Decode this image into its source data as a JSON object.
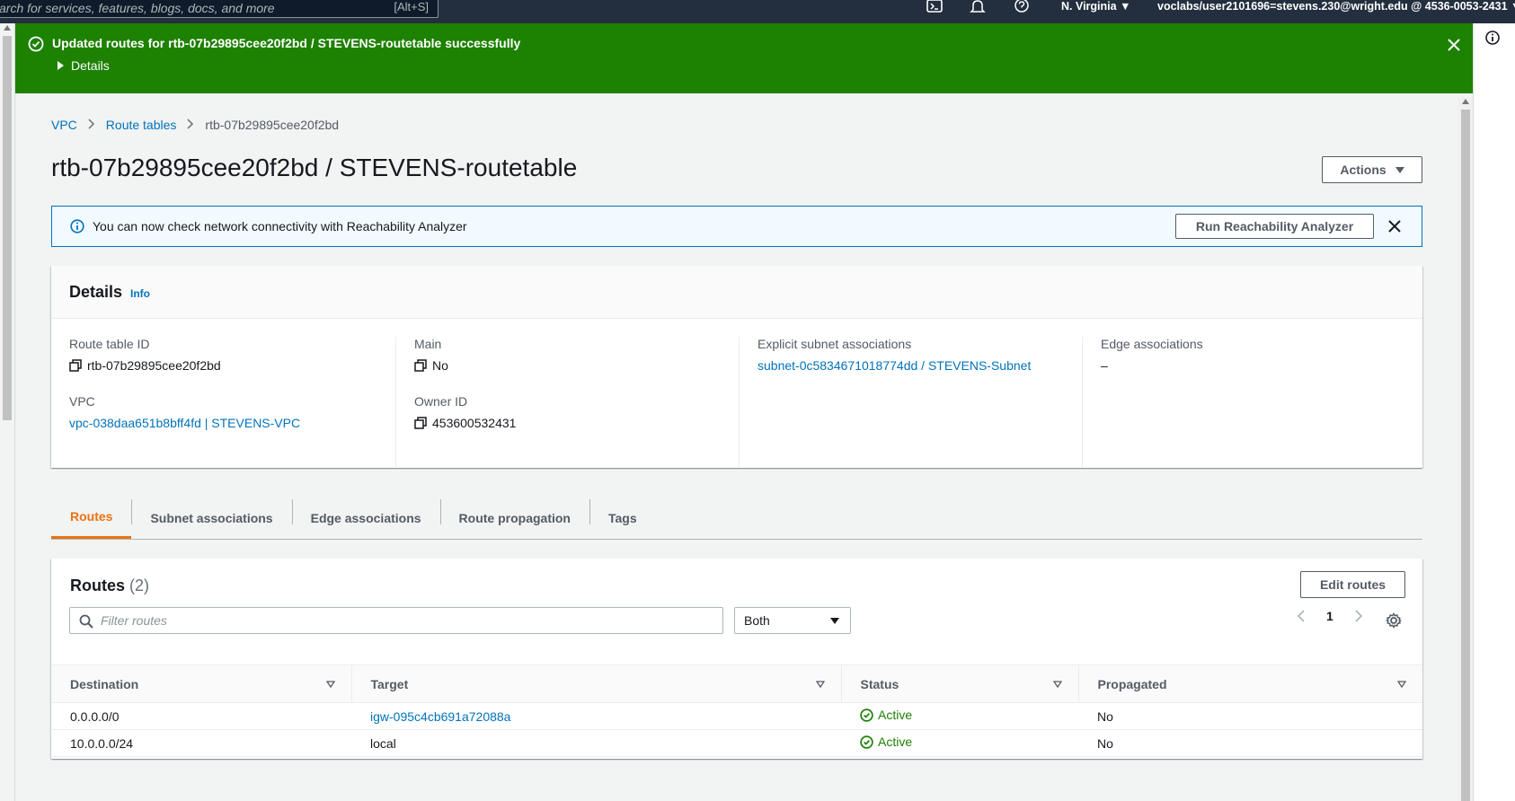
{
  "topnav": {
    "search_placeholder": "arch for services, features, blogs, docs, and more",
    "search_shortcut": "[Alt+S]",
    "region": "N. Virginia ▼",
    "account": "voclabs/user2101696=stevens.230@wright.edu @ 4536-0053-2431 ▼"
  },
  "flash": {
    "message": "Updated routes for rtb-07b29895cee20f2bd / STEVENS-routetable successfully",
    "details_label": "Details",
    "color": "#1d8102"
  },
  "breadcrumb": {
    "items": [
      "VPC",
      "Route tables",
      "rtb-07b29895cee20f2bd"
    ]
  },
  "page": {
    "title": "rtb-07b29895cee20f2bd / STEVENS-routetable",
    "actions_label": "Actions"
  },
  "info_banner": {
    "text": "You can now check network connectivity with Reachability Analyzer",
    "button_label": "Run Reachability Analyzer"
  },
  "details": {
    "title": "Details",
    "info_link": "Info",
    "route_table_id_label": "Route table ID",
    "route_table_id": "rtb-07b29895cee20f2bd",
    "vpc_label": "VPC",
    "vpc": "vpc-038daa651b8bff4fd | STEVENS-VPC",
    "main_label": "Main",
    "main": "No",
    "owner_id_label": "Owner ID",
    "owner_id": "453600532431",
    "explicit_subnet_label": "Explicit subnet associations",
    "explicit_subnet": "subnet-0c5834671018774dd / STEVENS-Subnet",
    "edge_assoc_label": "Edge associations",
    "edge_assoc": "–"
  },
  "tabs": [
    "Routes",
    "Subnet associations",
    "Edge associations",
    "Route propagation",
    "Tags"
  ],
  "routes": {
    "title": "Routes",
    "count": "(2)",
    "edit_label": "Edit routes",
    "filter_placeholder": "Filter routes",
    "select_value": "Both",
    "page": "1",
    "columns": [
      "Destination",
      "Target",
      "Status",
      "Propagated"
    ],
    "rows": [
      {
        "destination": "0.0.0.0/0",
        "target": "igw-095c4cb691a72088a",
        "status": "Active",
        "propagated": "No"
      },
      {
        "destination": "10.0.0.0/24",
        "target": "local",
        "status": "Active",
        "propagated": "No"
      }
    ]
  },
  "colors": {
    "link": "#0073bb",
    "active_tab": "#ec7211",
    "success": "#1d8102",
    "nav_bg": "#232f3e"
  }
}
